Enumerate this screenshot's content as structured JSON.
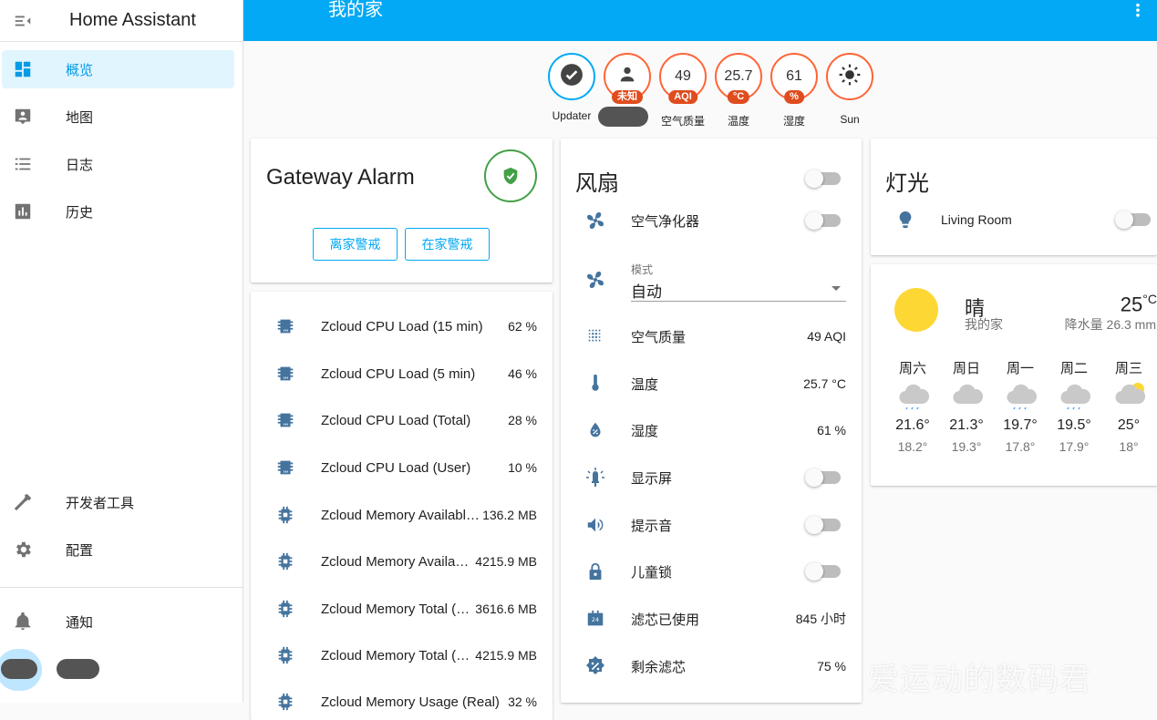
{
  "sidebar": {
    "title": "Home Assistant",
    "items": [
      {
        "label": "概览",
        "icon": "dashboard-icon"
      },
      {
        "label": "地图",
        "icon": "map-icon"
      },
      {
        "label": "日志",
        "icon": "logbook-icon"
      },
      {
        "label": "历史",
        "icon": "history-icon"
      }
    ],
    "bottom_items": [
      {
        "label": "开发者工具",
        "icon": "hammer-icon"
      },
      {
        "label": "配置",
        "icon": "gear-icon"
      }
    ],
    "notifications": {
      "label": "通知",
      "icon": "bell-icon"
    }
  },
  "header": {
    "title": "我的家"
  },
  "badges": [
    {
      "value": "",
      "icon": "check-icon",
      "tag": "",
      "caption": "Updater"
    },
    {
      "value": "",
      "icon": "person-icon",
      "tag": "未知",
      "caption": ""
    },
    {
      "value": "49",
      "tag": "AQI",
      "caption": "空气质量"
    },
    {
      "value": "25.7",
      "tag": "°C",
      "caption": "温度"
    },
    {
      "value": "61",
      "tag": "%",
      "caption": "湿度"
    },
    {
      "value": "",
      "icon": "sun-icon",
      "tag": "",
      "caption": "Sun"
    }
  ],
  "alarm": {
    "title": "Gateway Alarm",
    "away_button": "离家警戒",
    "home_button": "在家警戒"
  },
  "sensors": [
    {
      "name": "Zcloud CPU Load (15 min)",
      "value": "62 %",
      "icon": "chip-icon"
    },
    {
      "name": "Zcloud CPU Load (5 min)",
      "value": "46 %",
      "icon": "chip-icon"
    },
    {
      "name": "Zcloud CPU Load (Total)",
      "value": "28 %",
      "icon": "chip-icon"
    },
    {
      "name": "Zcloud CPU Load (User)",
      "value": "10 %",
      "icon": "chip-icon"
    },
    {
      "name": "Zcloud Memory Availabl…",
      "value": "136.2 MB",
      "icon": "memory-icon"
    },
    {
      "name": "Zcloud Memory Availa…",
      "value": "4215.9 MB",
      "icon": "memory-icon"
    },
    {
      "name": "Zcloud Memory Total (…",
      "value": "3616.6 MB",
      "icon": "memory-icon"
    },
    {
      "name": "Zcloud Memory Total (…",
      "value": "4215.9 MB",
      "icon": "memory-icon"
    },
    {
      "name": "Zcloud Memory Usage (Real)",
      "value": "32 %",
      "icon": "memory-icon"
    }
  ],
  "fan": {
    "title": "风扇",
    "purifier": "空气净化器",
    "mode_label": "模式",
    "mode_value": "自动",
    "rows": [
      {
        "name": "空气质量",
        "value": "49 AQI"
      },
      {
        "name": "温度",
        "value": "25.7 °C"
      },
      {
        "name": "湿度",
        "value": "61 %"
      }
    ],
    "toggles": [
      "显示屏",
      "提示音",
      "儿童锁"
    ],
    "filter_used": {
      "name": "滤芯已使用",
      "value": "845 小时"
    },
    "filter_left": {
      "name": "剩余滤芯",
      "value": "75 %"
    }
  },
  "lights": {
    "title": "灯光",
    "item": "Living Room"
  },
  "weather": {
    "condition": "晴",
    "location": "我的家",
    "temp": "25",
    "unit": "°C",
    "precip": "降水量 26.3 mm",
    "forecast": [
      {
        "day": "周六",
        "hi": "21.6°",
        "lo": "18.2°"
      },
      {
        "day": "周日",
        "hi": "21.3°",
        "lo": "19.3°"
      },
      {
        "day": "周一",
        "hi": "19.7°",
        "lo": "17.8°"
      },
      {
        "day": "周二",
        "hi": "19.5°",
        "lo": "17.9°"
      },
      {
        "day": "周三",
        "hi": "25°",
        "lo": "18°"
      }
    ]
  },
  "watermark": "爱运动的数码君",
  "colors": {
    "primary": "#03a9f4",
    "badge_border": "#ff6536",
    "badge_tag": "#df4c1e",
    "icon": "#44739e",
    "alarm": "#43a047"
  }
}
